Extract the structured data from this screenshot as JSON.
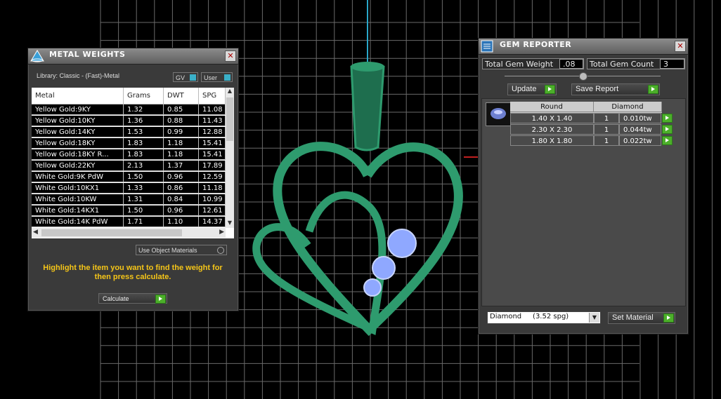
{
  "metal_panel": {
    "title": "METAL WEIGHTS",
    "close": "✕",
    "library_label": "Library: Classic - (Fast)-Metal",
    "gv_label": "GV",
    "user_label": "User",
    "columns": [
      "Metal",
      "Grams",
      "DWT",
      "SPG"
    ],
    "rows": [
      [
        "Yellow Gold:9KY",
        "1.32",
        "0.85",
        "11.08"
      ],
      [
        "Yellow Gold:10KY",
        "1.36",
        "0.88",
        "11.43"
      ],
      [
        "Yellow Gold:14KY",
        "1.53",
        "0.99",
        "12.88"
      ],
      [
        "Yellow Gold:18KY",
        "1.83",
        "1.18",
        "15.41"
      ],
      [
        "Yellow Gold:18KY R...",
        "1.83",
        "1.18",
        "15.41"
      ],
      [
        "Yellow Gold:22KY",
        "2.13",
        "1.37",
        "17.89"
      ],
      [
        "White Gold:9K PdW",
        "1.50",
        "0.96",
        "12.59"
      ],
      [
        "White Gold:10KX1",
        "1.33",
        "0.86",
        "11.18"
      ],
      [
        "White Gold:10KW",
        "1.31",
        "0.84",
        "10.99"
      ],
      [
        "White Gold:14KX1",
        "1.50",
        "0.96",
        "12.61"
      ],
      [
        "White Gold:14K PdW",
        "1.71",
        "1.10",
        "14.37"
      ]
    ],
    "use_object_materials": "Use Object Materials",
    "hint": "Highlight the item you want to find the weight for then press calculate.",
    "calculate_label": "Calculate"
  },
  "gem_panel": {
    "title": "GEM REPORTER",
    "close": "✕",
    "total_weight_label": "Total Gem Weight",
    "total_weight_value": ".08",
    "total_count_label": "Total Gem Count",
    "total_count_value": "3",
    "update_label": "Update",
    "save_report_label": "Save Report",
    "columns": [
      "Round",
      "Diamond"
    ],
    "rows": [
      [
        "1.40 X 1.40",
        "1",
        "0.010tw"
      ],
      [
        "2.30 X 2.30",
        "1",
        "0.044tw"
      ],
      [
        "1.80 X 1.80",
        "1",
        "0.022tw"
      ]
    ],
    "material_select": "Diamond     (3.52 spg)",
    "set_material_label": "Set Material"
  },
  "colors": {
    "viewport_bg": "#000000",
    "grid": "#6a6a6a",
    "model": "#2e9b6e",
    "gem": "#8fa8ff",
    "hint_text": "#f5c518"
  }
}
